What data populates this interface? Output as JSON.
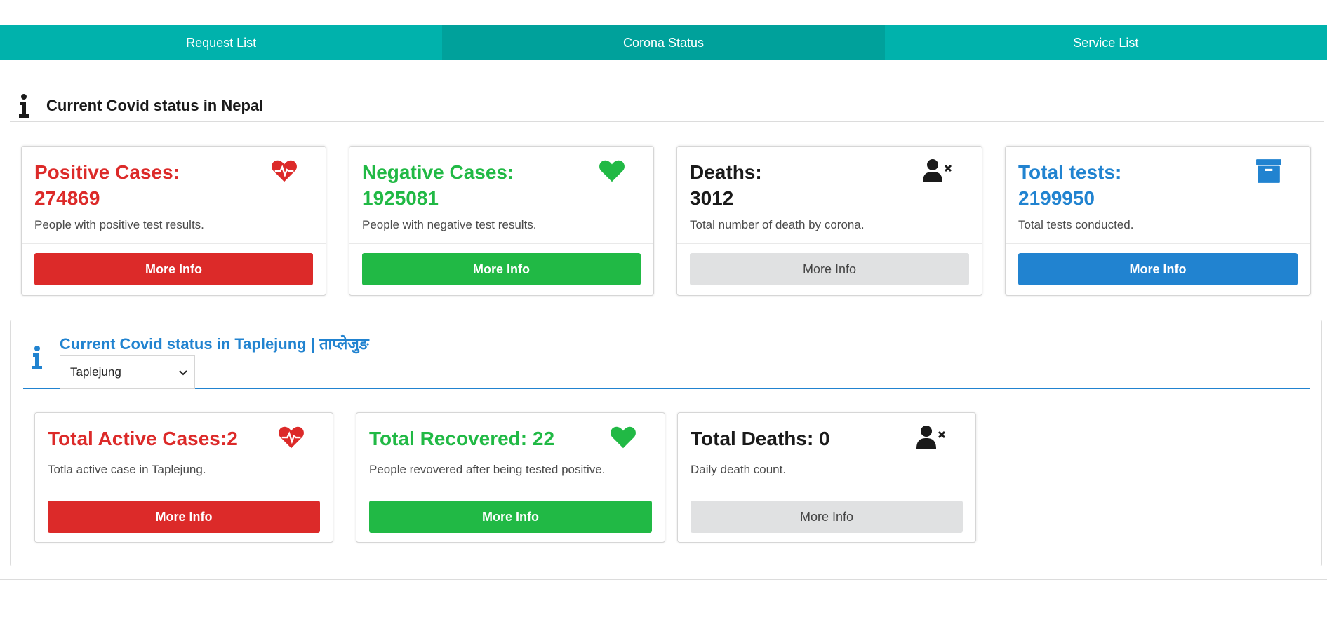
{
  "nav": {
    "tabs": [
      {
        "label": "Request List",
        "active": false
      },
      {
        "label": "Corona Status",
        "active": true
      },
      {
        "label": "Service List",
        "active": false
      }
    ]
  },
  "national": {
    "title": "Current Covid status in Nepal",
    "cards": [
      {
        "title": "Positive Cases:",
        "value": "274869",
        "description": "People with positive test results.",
        "button": "More Info",
        "icon": "heartbeat-icon",
        "color": "#dc2a29"
      },
      {
        "title": "Negative Cases:",
        "value": "1925081",
        "description": "People with negative test results.",
        "button": "More Info",
        "icon": "heart-icon",
        "color": "#21b945"
      },
      {
        "title": "Deaths:",
        "value": "3012",
        "description": "Total number of death by corona.",
        "button": "More Info",
        "icon": "user-remove-icon",
        "color": "#1a1a1a"
      },
      {
        "title": "Total tests:",
        "value": "2199950",
        "description": "Total tests conducted.",
        "button": "More Info",
        "icon": "archive-icon",
        "color": "#2183d0"
      }
    ]
  },
  "district": {
    "title": "Current Covid status in Taplejung | ताप्लेजुङ",
    "select_value": "Taplejung",
    "cards": [
      {
        "title": "Total Active Cases:2",
        "description": "Totla active case in Taplejung.",
        "button": "More Info",
        "icon": "heartbeat-icon"
      },
      {
        "title": "Total Recovered: 22",
        "description": "People revovered after being tested positive.",
        "button": "More Info",
        "icon": "heart-icon"
      },
      {
        "title": "Total Deaths: 0",
        "description": "Daily death count.",
        "button": "More Info",
        "icon": "user-remove-icon"
      }
    ]
  },
  "colors": {
    "teal": "#00b2ac",
    "red": "#dc2a29",
    "green": "#21b945",
    "blue": "#2183d0",
    "gray": "#e0e1e2"
  }
}
